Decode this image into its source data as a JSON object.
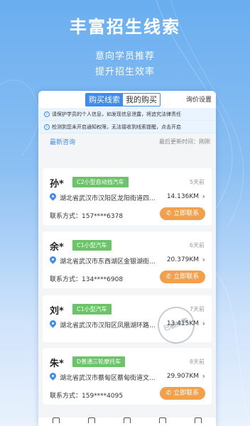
{
  "hero": {
    "title": "丰富招生线索",
    "line1": "意向学员推荐",
    "line2": "提升招生效率"
  },
  "tabs": {
    "buy_leads": "购买线索",
    "my_purchases": "我的购买",
    "inquiry_settings": "询价设置"
  },
  "notices": [
    "请保护学员的个人信息，如发现信息泄露，将追究法律责任",
    "检测到您未开启通知权限，无法接收到线索提醒，点击开启"
  ],
  "latest": {
    "label": "最新咨询",
    "updated": "最后更新时间：刚刚"
  },
  "cards": [
    {
      "name": "孙*",
      "tag": "C2小型自动挡汽车",
      "time": "5天前",
      "address": "湖北省武汉市汉阳区龙阳街道四...",
      "distance": "14.136KM",
      "contact": "联系方式：157****6378",
      "button": "立即联系"
    },
    {
      "name": "余*",
      "tag": "C1小型汽车",
      "time": "6天前",
      "address": "湖北省武汉市东西湖区金银湖街...",
      "distance": "20.379KM",
      "contact": "联系方式：134****6908",
      "button": "立即联系"
    },
    {
      "name": "刘*",
      "tag": "C1小型汽车",
      "time": "7天前",
      "address": "湖北省武汉市汉阳区凤凰湖环路...",
      "distance": "13.415KM",
      "contact": "",
      "button": "",
      "stamp": "已被抢购"
    },
    {
      "name": "朱*",
      "tag": "D普通三轮摩托车",
      "time": "8天前",
      "address": "湖北省武汉市蔡甸区蔡甸街道文...",
      "distance": "29.907KM",
      "contact": "联系方式：159****4095",
      "button": "立即联系"
    }
  ],
  "colors": {
    "accent": "#3d8cf0",
    "tag_green": "#6cc36a",
    "button_orange": "#f2a04c"
  }
}
